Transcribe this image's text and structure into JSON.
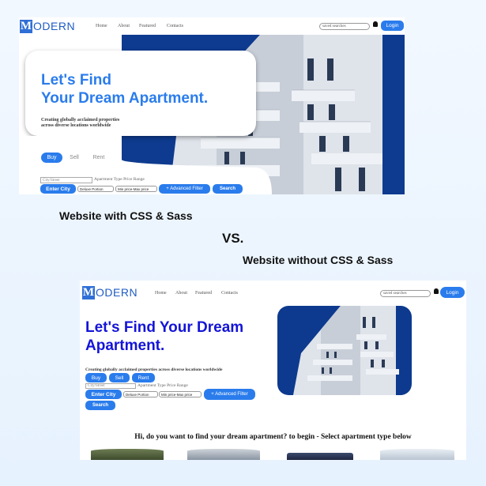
{
  "captions": {
    "with_css": "Website with CSS & Sass",
    "vs": "VS.",
    "without_css": "Website without CSS & Sass"
  },
  "site": {
    "logo_letter": "M",
    "logo_text": "ODERN",
    "nav": [
      "Home",
      "About",
      "Featured",
      "Contacts"
    ],
    "saved_searches_placeholder": "saved searches",
    "login_label": "Login",
    "hero_title_line1": "Let's Find",
    "hero_title_line2": "Your Dream Apartment.",
    "hero_title_full": "Let's Find Your Dream Apartment.",
    "subtitle_line1": "Creating globally acclaimed properties",
    "subtitle_line2": "across diverse locations worldwide",
    "subtitle_full": "Creating globally acclaimed properties across diverse locations worldwide",
    "tabs": [
      "Buy",
      "Sell",
      "Rent"
    ],
    "city_placeholder": "City/Street",
    "filter_labels": "Apartment Type Price Range",
    "enter_city_label": "Enter City",
    "apartment_type_value": "Deluxe Portion",
    "price_value": "Min price-Max price",
    "advanced_filter_label": "+ Advanced Filter",
    "search_label": "Search",
    "apartment_type_question": "Hi, do you want to find your dream apartment? to begin - Select apartment type below"
  },
  "colors": {
    "accent": "#2a7cec",
    "hero_bg": "#0e3b8f",
    "unstyled_title": "#1414d8",
    "page_bg": "#e9f4fe"
  }
}
